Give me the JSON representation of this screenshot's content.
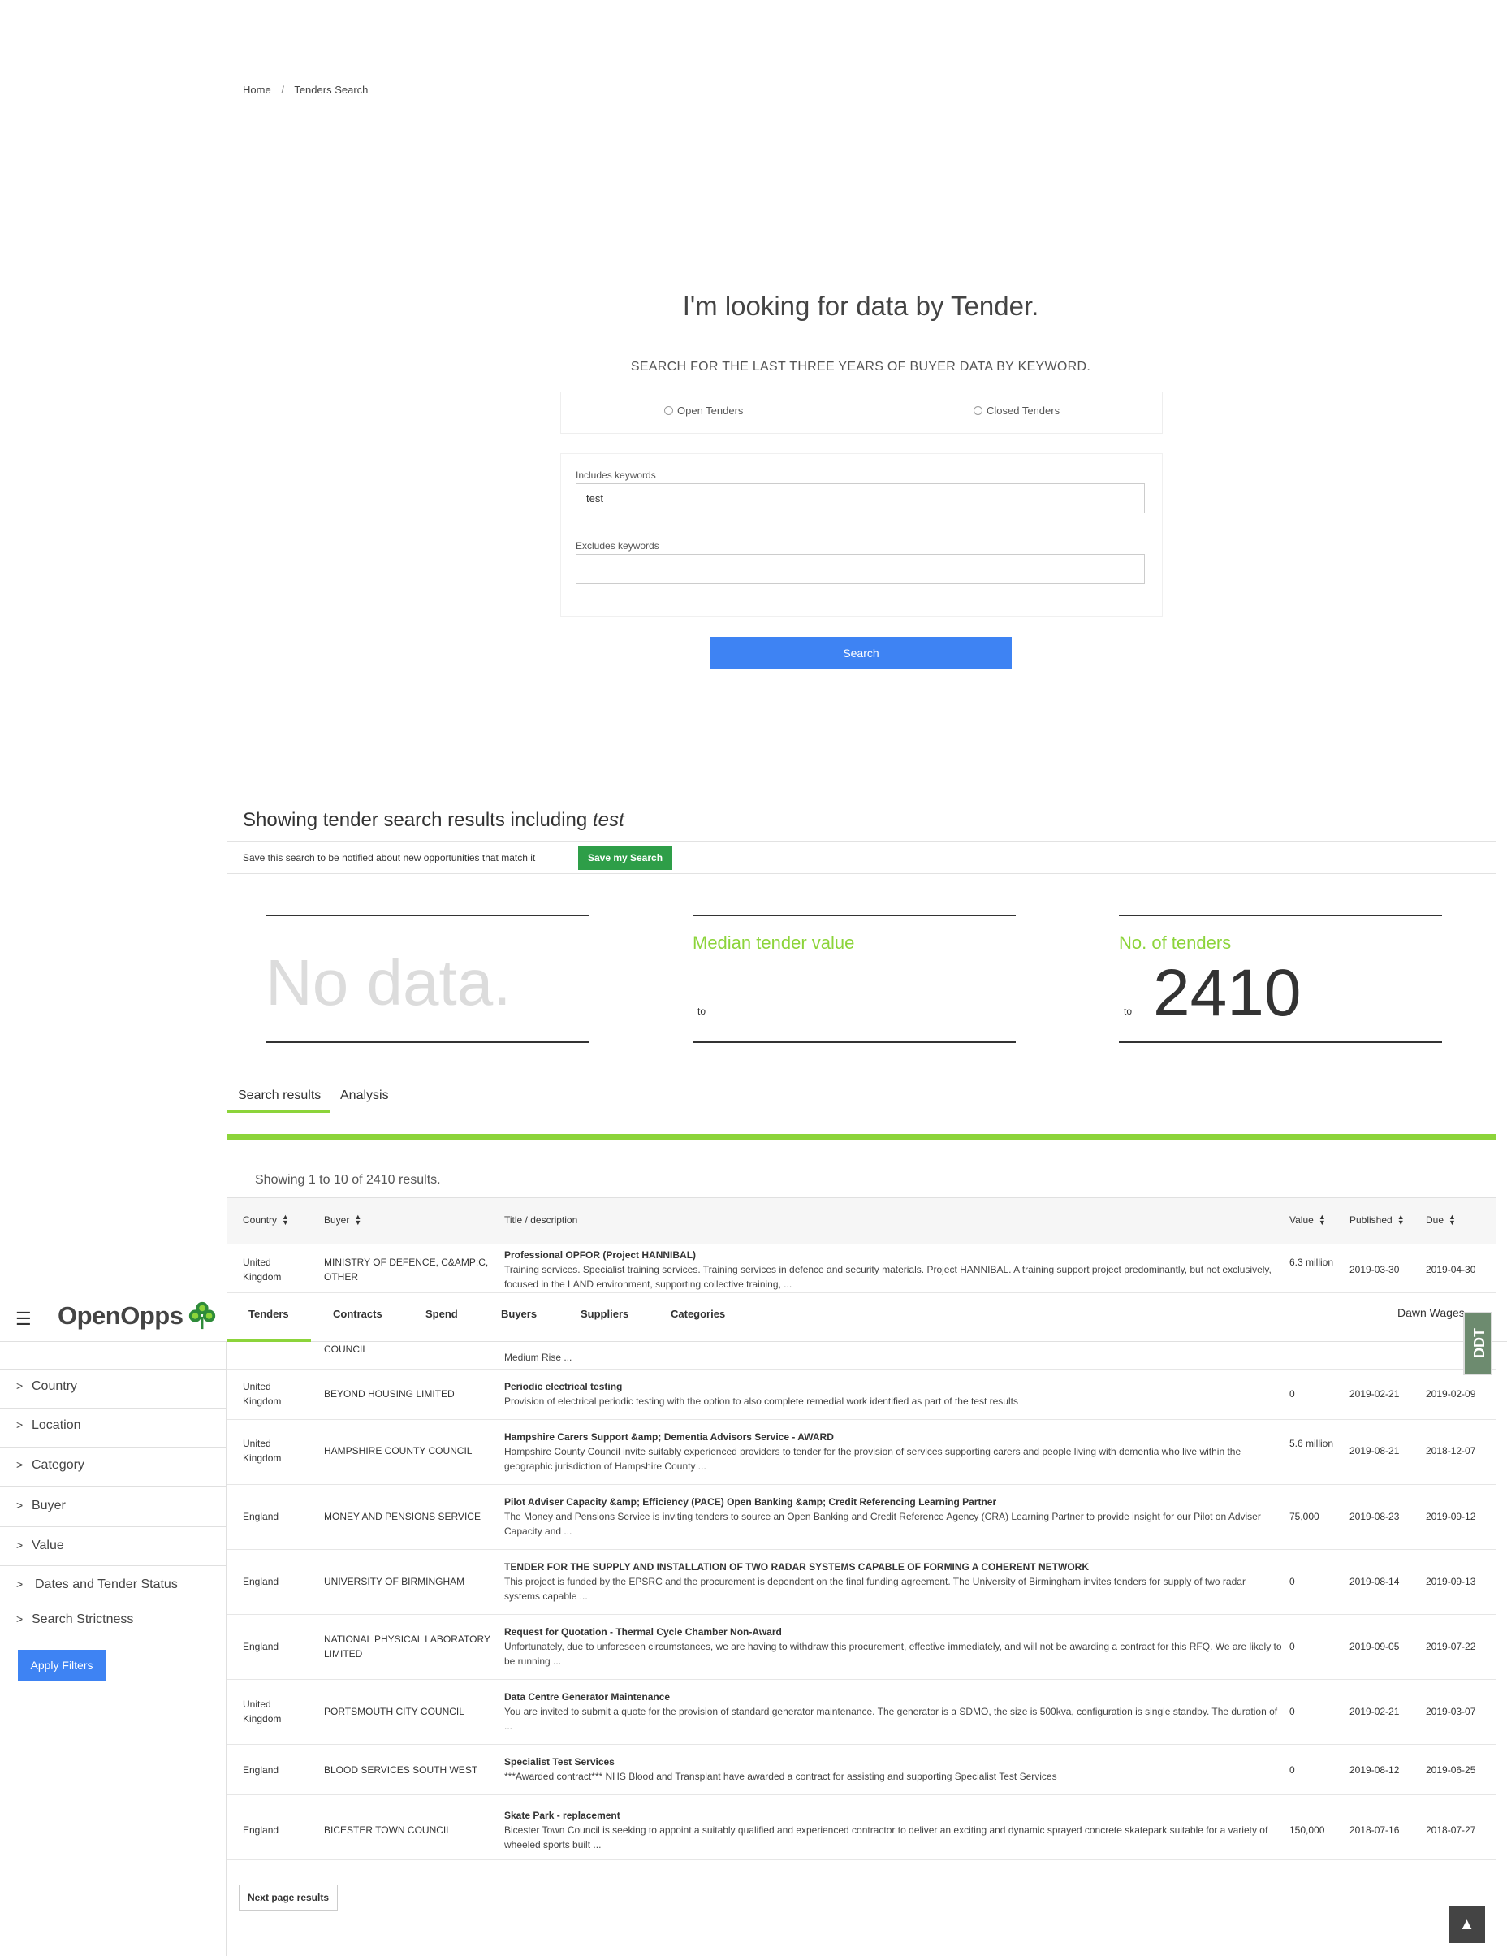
{
  "breadcrumb": {
    "home": "Home",
    "separator": "/",
    "current": "Tenders Search"
  },
  "hero": {
    "title": "I'm looking for data by Tender.",
    "subtitle": "SEARCH FOR THE LAST THREE YEARS OF BUYER DATA BY KEYWORD."
  },
  "radios": {
    "open": "Open Tenders",
    "closed": "Closed Tenders"
  },
  "keywords": {
    "includes_label": "Includes keywords",
    "includes_value": "test",
    "excludes_label": "Excludes keywords",
    "excludes_value": ""
  },
  "search_button": "Search",
  "results": {
    "heading_prefix": "Showing tender search results including",
    "heading_term": "test",
    "save_text": "Save this search to be notified about new opportunities that match it",
    "save_button": "Save my Search"
  },
  "stats": {
    "no_data": "No data.",
    "median_title": "Median tender value",
    "median_to": "to",
    "count_title": "No. of tenders",
    "count_to": "to",
    "count_value": "2410"
  },
  "tabs": {
    "search_results": "Search results",
    "analysis": "Analysis"
  },
  "showing": "Showing 1 to 10 of 2410 results.",
  "table": {
    "headers": {
      "country": "Country",
      "buyer": "Buyer",
      "title": "Title / description",
      "value": "Value",
      "published": "Published",
      "due": "Due"
    },
    "rows": [
      {
        "country": "United Kingdom",
        "buyer": "MINISTRY OF DEFENCE, C&AMP;C, OTHER",
        "title": "Professional OPFOR (Project HANNIBAL)",
        "desc": "Training services. Specialist training services. Training services in defence and security materials. Project HANNIBAL. A training support project predominantly, but not exclusively, focused in the LAND environment, supporting collective training, ...",
        "value": "6.3 million",
        "published": "2019-03-30",
        "due": "2019-04-30"
      },
      {
        "country": "",
        "buyer": "COUNCIL",
        "title": "",
        "desc": "Medium Rise ...",
        "value": "",
        "published": "",
        "due": ""
      },
      {
        "country": "United Kingdom",
        "buyer": "BEYOND HOUSING LIMITED",
        "title": "Periodic electrical testing",
        "desc": "Provision of electrical periodic testing with the option to also complete remedial work identified as part of the test results",
        "value": "0",
        "published": "2019-02-21",
        "due": "2019-02-09"
      },
      {
        "country": "United Kingdom",
        "buyer": "HAMPSHIRE COUNTY COUNCIL",
        "title": "Hampshire Carers Support &amp; Dementia Advisors Service - AWARD",
        "desc": "Hampshire County Council invite suitably experienced providers to tender for the provision of services supporting carers and people living with dementia who live within the geographic jurisdiction of Hampshire County ...",
        "value": "5.6 million",
        "published": "2019-08-21",
        "due": "2018-12-07"
      },
      {
        "country": "England",
        "buyer": "MONEY AND PENSIONS SERVICE",
        "title": "Pilot Adviser Capacity &amp; Efficiency (PACE) Open Banking &amp; Credit Referencing Learning Partner",
        "desc": "The Money and Pensions Service is inviting tenders to source an Open Banking and Credit Reference Agency (CRA) Learning Partner to provide insight for our Pilot on Adviser Capacity and ...",
        "value": "75,000",
        "published": "2019-08-23",
        "due": "2019-09-12"
      },
      {
        "country": "England",
        "buyer": "UNIVERSITY OF BIRMINGHAM",
        "title": "TENDER FOR THE SUPPLY AND INSTALLATION OF TWO RADAR SYSTEMS CAPABLE OF FORMING A COHERENT NETWORK",
        "desc": "This project is funded by the EPSRC and the procurement is dependent on the final funding agreement. The University of Birmingham invites tenders for supply of two radar systems capable ...",
        "value": "0",
        "published": "2019-08-14",
        "due": "2019-09-13"
      },
      {
        "country": "England",
        "buyer": "NATIONAL PHYSICAL LABORATORY LIMITED",
        "title": "Request for Quotation - Thermal Cycle Chamber Non-Award",
        "desc": "Unfortunately, due to unforeseen circumstances, we are having to withdraw this procurement, effective immediately, and will not be awarding a contract for this RFQ. We are likely to be running ...",
        "value": "0",
        "published": "2019-09-05",
        "due": "2019-07-22"
      },
      {
        "country": "United Kingdom",
        "buyer": "PORTSMOUTH CITY COUNCIL",
        "title": "Data Centre Generator Maintenance",
        "desc": "You are invited to submit a quote for the provision of standard generator maintenance. The generator is a SDMO, the size is 500kva, configuration is single standby. The duration of ...",
        "value": "0",
        "published": "2019-02-21",
        "due": "2019-03-07"
      },
      {
        "country": "England",
        "buyer": "BLOOD SERVICES SOUTH WEST",
        "title": "Specialist Test Services",
        "desc": "***Awarded contract*** NHS Blood and Transplant have awarded a contract for assisting and supporting Specialist Test Services",
        "value": "0",
        "published": "2019-08-12",
        "due": "2019-06-25"
      },
      {
        "country": "England",
        "buyer": "BICESTER TOWN COUNCIL",
        "title": "Skate Park - replacement",
        "desc": "Bicester Town Council is seeking to appoint a suitably qualified and experienced contractor to deliver an exciting and dynamic sprayed concrete skatepark suitable for a variety of wheeled sports built ...",
        "value": "150,000",
        "published": "2018-07-16",
        "due": "2018-07-27"
      }
    ]
  },
  "nav": {
    "logo": "OpenOpps",
    "items": [
      "Tenders",
      "Contracts",
      "Spend",
      "Buyers",
      "Suppliers",
      "Categories"
    ],
    "user": "Dawn Wages",
    "side_tab": "DDT"
  },
  "sidebar": {
    "filters": [
      "Country",
      "Location",
      "Category",
      "Buyer",
      "Value",
      "Dates and Tender Status",
      "Search Strictness"
    ],
    "apply": "Apply Filters"
  },
  "next_page": "Next page results",
  "colors": {
    "accent_green": "#8cd43a",
    "primary_blue": "#3e83f3",
    "save_green": "#2e9e48"
  },
  "icons": [
    "hamburger-icon",
    "clover-logo-icon",
    "chevron-right-icon",
    "sort-icon",
    "arrow-up-icon",
    "radio-icon",
    "caret-down-icon"
  ]
}
